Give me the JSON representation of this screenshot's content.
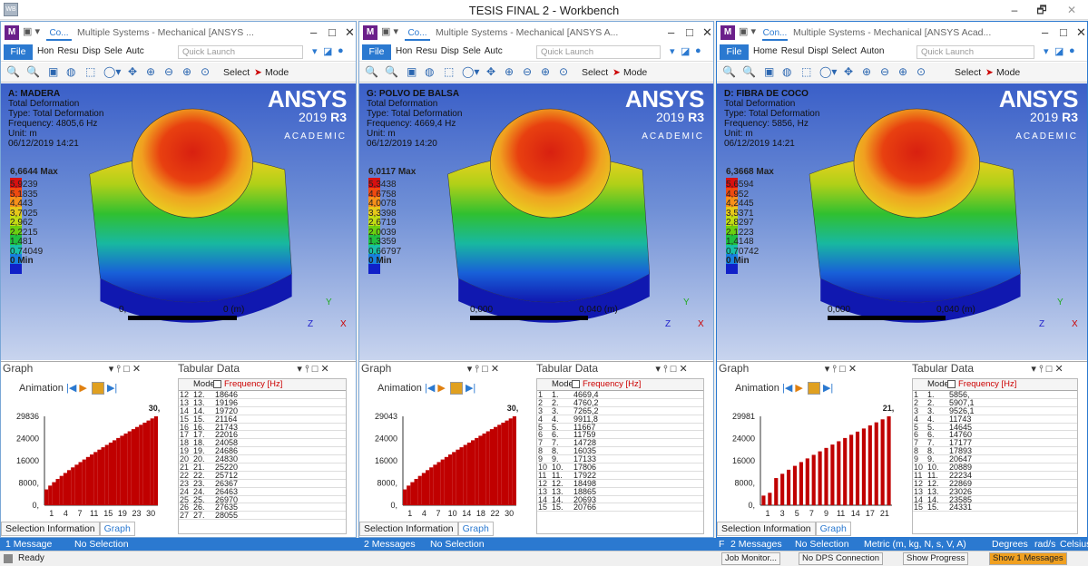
{
  "window": {
    "title": "TESIS FINAL 2 - Workbench",
    "min": "–",
    "restore": "🗗",
    "close": "✕",
    "app_icon": "WB"
  },
  "ribbon": {
    "file": "File",
    "quick_launch_placeholder": "Quick Launch",
    "select": "Select",
    "mode": "Mode"
  },
  "panes": [
    {
      "tab": "Co...",
      "title": "Multiple Systems - Mechanical [ANSYS ...",
      "ribbon_tabs": [
        "Hon",
        "Resu",
        "Disp",
        "Sele",
        "Autc"
      ],
      "info": {
        "name": "A: MADERA",
        "type1": "Total Deformation",
        "type2": "Type: Total Deformation",
        "freq": "Frequency: 4805,6 Hz",
        "unit": "Unit: m",
        "date": "06/12/2019 14:21"
      },
      "legend": {
        "max": "6,6644 Max",
        "min": "0 Min",
        "values": [
          "5,9239",
          "5,1835",
          "4,443",
          "3,7025",
          "2,962",
          "2,2215",
          "1,481",
          "0,74049"
        ]
      },
      "scale": {
        "left": "0,",
        "right": "0 (m)"
      },
      "graph": {
        "title": "Graph",
        "tabular": "Tabular Data",
        "animation": "Animation",
        "sel_info": "Selection Information",
        "graph_tab": "Graph",
        "y_ticks": [
          "29836",
          "24000",
          "16000",
          "8000,",
          "0,"
        ],
        "x_ticks": [
          "1",
          "4",
          "7",
          "11",
          "15",
          "19",
          "23",
          "30"
        ],
        "top_label": "30,"
      },
      "table_header": {
        "mode": "Mode",
        "freq": "Frequency [Hz]"
      },
      "rows": [
        [
          "12",
          "12.",
          "18646"
        ],
        [
          "13",
          "13.",
          "19196"
        ],
        [
          "14",
          "14.",
          "19720"
        ],
        [
          "15",
          "15.",
          "21164"
        ],
        [
          "16",
          "16.",
          "21743"
        ],
        [
          "17",
          "17.",
          "22016"
        ],
        [
          "18",
          "18.",
          "24058"
        ],
        [
          "19",
          "19.",
          "24686"
        ],
        [
          "20",
          "20.",
          "24830"
        ],
        [
          "21",
          "21.",
          "25220"
        ],
        [
          "22",
          "22.",
          "25712"
        ],
        [
          "23",
          "23.",
          "26367"
        ],
        [
          "24",
          "24.",
          "26463"
        ],
        [
          "25",
          "25.",
          "26970"
        ],
        [
          "26",
          "26.",
          "27635"
        ],
        [
          "27",
          "27.",
          "28055"
        ]
      ]
    },
    {
      "tab": "Co...",
      "title": "Multiple Systems - Mechanical [ANSYS A...",
      "ribbon_tabs": [
        "Hon",
        "Resu",
        "Disp",
        "Sele",
        "Autc"
      ],
      "info": {
        "name": "G: POLVO DE BALSA",
        "type1": "Total Deformation",
        "type2": "Type: Total Deformation",
        "freq": "Frequency: 4669,4 Hz",
        "unit": "Unit: m",
        "date": "06/12/2019 14:20"
      },
      "legend": {
        "max": "6,0117 Max",
        "min": "0 Min",
        "values": [
          "5,3438",
          "4,6758",
          "4,0078",
          "3,3398",
          "2,6719",
          "2,0039",
          "1,3359",
          "0,66797"
        ]
      },
      "scale": {
        "left": "0,000",
        "right": "0,040 (m)"
      },
      "graph": {
        "title": "Graph",
        "tabular": "Tabular Data",
        "animation": "Animation",
        "sel_info": "Selection Information",
        "graph_tab": "Graph",
        "y_ticks": [
          "29043",
          "24000",
          "16000",
          "8000,",
          "0,"
        ],
        "x_ticks": [
          "1",
          "4",
          "7",
          "10",
          "14",
          "18",
          "22",
          "30"
        ],
        "top_label": "30,"
      },
      "table_header": {
        "mode": "Mode",
        "freq": "Frequency [Hz]"
      },
      "rows": [
        [
          "1",
          "1.",
          "4669,4"
        ],
        [
          "2",
          "2.",
          "4760,2"
        ],
        [
          "3",
          "3.",
          "7265,2"
        ],
        [
          "4",
          "4.",
          "9911,8"
        ],
        [
          "5",
          "5.",
          "11667"
        ],
        [
          "6",
          "6.",
          "11759"
        ],
        [
          "7",
          "7.",
          "14728"
        ],
        [
          "8",
          "8.",
          "16035"
        ],
        [
          "9",
          "9.",
          "17133"
        ],
        [
          "10",
          "10.",
          "17806"
        ],
        [
          "11",
          "11.",
          "17922"
        ],
        [
          "12",
          "12.",
          "18498"
        ],
        [
          "13",
          "13.",
          "18865"
        ],
        [
          "14",
          "14.",
          "20693"
        ],
        [
          "15",
          "15.",
          "20766"
        ]
      ]
    },
    {
      "tab": "Con...",
      "title": "Multiple Systems - Mechanical [ANSYS Acad...",
      "ribbon_tabs": [
        "Home",
        "Resul",
        "Displ",
        "Select",
        "Auton"
      ],
      "info": {
        "name": "D: FIBRA DE COCO",
        "type1": "Total Deformation",
        "type2": "Type: Total Deformation",
        "freq": "Frequency: 5856, Hz",
        "unit": "Unit: m",
        "date": "06/12/2019 14:21"
      },
      "legend": {
        "max": "6,3668 Max",
        "min": "0 Min",
        "values": [
          "5,6594",
          "4,952",
          "4,2445",
          "3,5371",
          "2,8297",
          "2,1223",
          "1,4148",
          "0,70742"
        ]
      },
      "scale": {
        "left": "0,000",
        "right": "0,040 (m)"
      },
      "graph": {
        "title": "Graph",
        "tabular": "Tabular Data",
        "animation": "Animation",
        "sel_info": "Selection Information",
        "graph_tab": "Graph",
        "y_ticks": [
          "29981",
          "24000",
          "16000",
          "8000,",
          "0,"
        ],
        "x_ticks": [
          "1",
          "3",
          "5",
          "7",
          "9",
          "11",
          "14",
          "17",
          "21"
        ],
        "top_label": "21,"
      },
      "table_header": {
        "mode": "Mode",
        "freq": "Frequency [Hz]"
      },
      "rows": [
        [
          "1",
          "1.",
          "5856,"
        ],
        [
          "2",
          "2.",
          "5907,1"
        ],
        [
          "3",
          "3.",
          "9526,1"
        ],
        [
          "4",
          "4.",
          "11743"
        ],
        [
          "5",
          "5.",
          "14645"
        ],
        [
          "6",
          "6.",
          "14760"
        ],
        [
          "7",
          "7.",
          "17177"
        ],
        [
          "8",
          "8.",
          "17893"
        ],
        [
          "9",
          "9.",
          "20647"
        ],
        [
          "10",
          "10.",
          "20889"
        ],
        [
          "11",
          "11.",
          "22234"
        ],
        [
          "12",
          "12.",
          "22869"
        ],
        [
          "13",
          "13.",
          "23026"
        ],
        [
          "14",
          "14.",
          "23585"
        ],
        [
          "15",
          "15.",
          "24331"
        ]
      ]
    }
  ],
  "chart_data": [
    {
      "type": "bar",
      "title": "",
      "xlabel": "",
      "ylabel": "",
      "ylim": [
        0,
        29836
      ],
      "bars": 30,
      "top_value": 29836
    },
    {
      "type": "bar",
      "title": "",
      "xlabel": "",
      "ylabel": "",
      "ylim": [
        0,
        29043
      ],
      "bars": 30,
      "top_value": 29043
    },
    {
      "type": "bar",
      "title": "",
      "xlabel": "",
      "ylabel": "",
      "ylim": [
        0,
        29981
      ],
      "bars": 21,
      "top_value": 29981
    }
  ],
  "status": {
    "p1": "1 Message",
    "p1b": "No Selection",
    "p2": "2 Messages",
    "p2b": "No Selection",
    "p3a": "F",
    "p3": "2 Messages",
    "p3b": "No Selection",
    "p3c": "Metric (m, kg, N, s, V, A)",
    "p3d": "Degrees",
    "p3e": "rad/s",
    "p3f": "Celsius"
  },
  "footer": {
    "ready": "Ready",
    "job": "Job Monitor...",
    "dps": "No DPS Connection",
    "progress": "Show Progress",
    "messages": "Show 1 Messages"
  }
}
